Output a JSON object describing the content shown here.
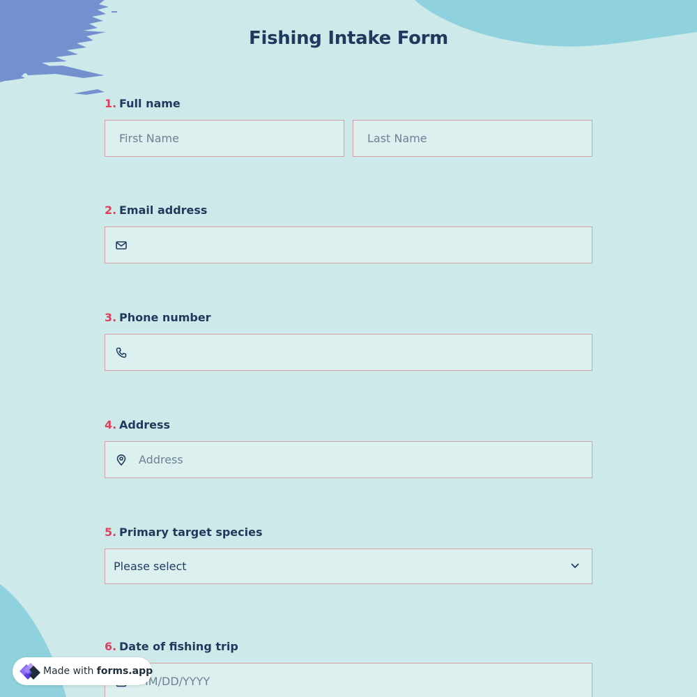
{
  "form": {
    "title": "Fishing Intake Form"
  },
  "questions": [
    {
      "number": "1.",
      "label": "Full name",
      "first_placeholder": "First Name",
      "last_placeholder": "Last Name"
    },
    {
      "number": "2.",
      "label": "Email address",
      "icon": "mail-icon"
    },
    {
      "number": "3.",
      "label": "Phone number",
      "icon": "phone-icon"
    },
    {
      "number": "4.",
      "label": "Address",
      "placeholder": "Address",
      "icon": "map-pin-icon"
    },
    {
      "number": "5.",
      "label": "Primary target species",
      "selected": "Please select",
      "icon": "chevron-down-icon"
    },
    {
      "number": "6.",
      "label": "Date of fishing trip",
      "placeholder": "MM/DD/YYYY",
      "icon": "calendar-icon"
    }
  ],
  "badge": {
    "prefix": "Made with",
    "brand": "forms.app"
  },
  "colors": {
    "background": "#cde9e9",
    "field_background": "#dcf0f0",
    "field_border": "#d5a0a6",
    "number_accent": "#e23d5f",
    "text": "#1f3a5c",
    "splash_blue": "#7590cf",
    "wave_teal": "#8fd2de"
  }
}
